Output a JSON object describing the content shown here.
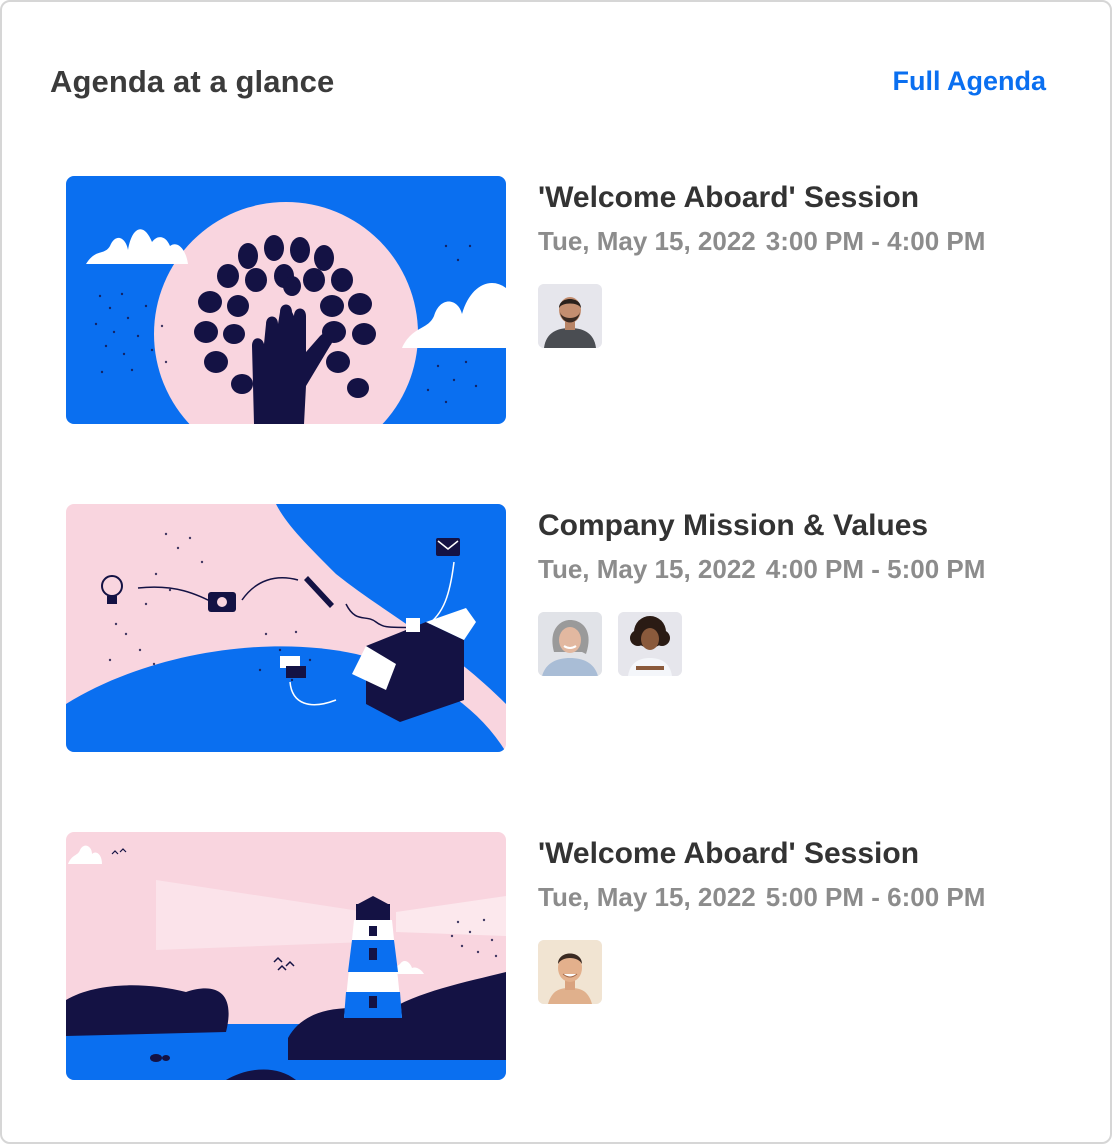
{
  "header": {
    "title": "Agenda at a glance",
    "full_agenda_link": "Full Agenda"
  },
  "colors": {
    "accent": "#0a6ff0",
    "illustration_blue": "#0a6ff0",
    "illustration_pink": "#f9d5df",
    "illustration_navy": "#141244"
  },
  "sessions": [
    {
      "title": "'Welcome Aboard' Session",
      "date": "Tue, May 15, 2022",
      "time": "3:00 PM - 4:00 PM",
      "thumbnail": "tree-hand-illustration",
      "speakers": [
        "avatar-man-beard"
      ]
    },
    {
      "title": "Company Mission & Values",
      "date": "Tue, May 15, 2022",
      "time": "4:00 PM - 5:00 PM",
      "thumbnail": "open-box-illustration",
      "speakers": [
        "avatar-woman-gray-hair",
        "avatar-woman-curly-hair"
      ]
    },
    {
      "title": "'Welcome Aboard' Session",
      "date": "Tue, May 15, 2022",
      "time": "5:00 PM - 6:00 PM",
      "thumbnail": "lighthouse-illustration",
      "speakers": [
        "avatar-man-smiling"
      ]
    }
  ]
}
